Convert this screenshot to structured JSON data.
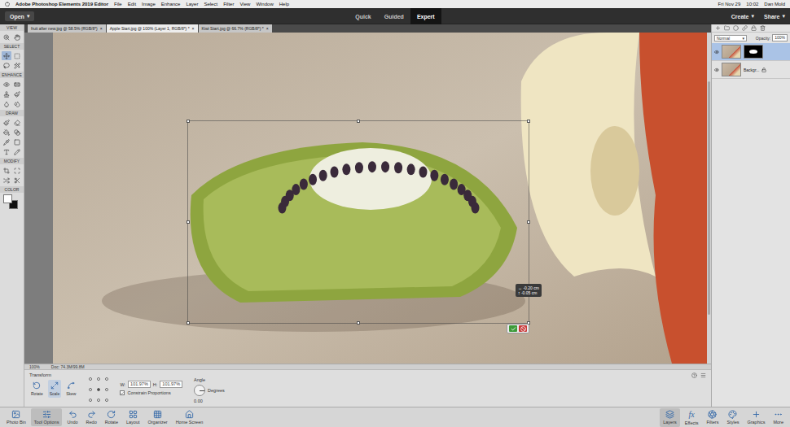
{
  "menubar": {
    "app": "Adobe Photoshop Elements 2019 Editor",
    "items": [
      "File",
      "Edit",
      "Image",
      "Enhance",
      "Layer",
      "Select",
      "Filter",
      "View",
      "Window",
      "Help"
    ],
    "date": "Fri Nov 29",
    "time": "10:02",
    "user": "Dan Mold"
  },
  "topbar": {
    "open": {
      "label": "Open",
      "arrow": "▾"
    },
    "modes": [
      {
        "label": "Quick",
        "selected": false
      },
      {
        "label": "Guided",
        "selected": false
      },
      {
        "label": "Expert",
        "selected": true
      }
    ],
    "actions": [
      {
        "label": "Create",
        "arrow": "▾"
      },
      {
        "label": "Share",
        "arrow": "▾"
      }
    ]
  },
  "doc_tabs": [
    {
      "label": "fruit after new.jpg @ 58.5% (RGB/8*)",
      "close": "×",
      "selected": false
    },
    {
      "label": "Apple Start.jpg @ 100% (Layer 1, RGB/8*) *",
      "close": "×",
      "selected": true
    },
    {
      "label": "Kiwi Start.jpg @ 66.7% (RGB/8*) *",
      "close": "×",
      "selected": false
    }
  ],
  "toolbox": {
    "sections": [
      {
        "label": "VIEW",
        "tools": [
          {
            "selected": false
          },
          {
            "selected": false
          }
        ]
      },
      {
        "label": "SELECT",
        "tools": [
          {
            "selected": true
          },
          {
            "selected": false
          },
          {
            "selected": false
          },
          {
            "selected": false
          }
        ]
      },
      {
        "label": "ENHANCE",
        "tools": [
          {
            "selected": false
          },
          {
            "selected": false
          },
          {
            "selected": false
          },
          {
            "selected": false
          },
          {
            "selected": false
          },
          {
            "selected": false
          }
        ]
      },
      {
        "label": "DRAW",
        "tools": [
          {
            "selected": false
          },
          {
            "selected": false
          },
          {
            "selected": false
          },
          {
            "selected": false
          },
          {
            "selected": false
          },
          {
            "selected": false
          },
          {
            "selected": false
          },
          {
            "selected": false
          }
        ]
      },
      {
        "label": "MODIFY",
        "tools": [
          {
            "selected": false
          },
          {
            "selected": false
          },
          {
            "selected": false
          },
          {
            "selected": false
          }
        ]
      },
      {
        "label": "COLOR",
        "swatches": [
          {
            "color": "#ffffff"
          },
          {
            "color": "#111111"
          }
        ]
      }
    ]
  },
  "canvas": {
    "readout": [
      {
        "glyph": "↔",
        "value": "-0.20 cm"
      },
      {
        "glyph": "↕",
        "value": "-0.05 cm"
      }
    ]
  },
  "status_bar": {
    "zoom": "100%",
    "doc": "Doc: 74.3M/99.8M"
  },
  "tool_options": {
    "title": "Transform",
    "modes": [
      {
        "label": "Rotate",
        "selected": false
      },
      {
        "label": "Scale",
        "selected": true
      },
      {
        "label": "Skew",
        "selected": false
      }
    ],
    "reference_points": [
      {
        "selected": false
      },
      {
        "selected": false
      },
      {
        "selected": false
      },
      {
        "selected": false
      },
      {
        "selected": true
      },
      {
        "selected": false
      },
      {
        "selected": false
      },
      {
        "selected": false
      },
      {
        "selected": false
      }
    ],
    "width": {
      "label": "W:",
      "value": "101.97%"
    },
    "height": {
      "label": "H:",
      "value": "101.97%"
    },
    "constrain": {
      "label": "Constrain Proportions",
      "checked": true
    },
    "angle": {
      "label": "Angle",
      "value": "0.00",
      "unit": "Degrees"
    }
  },
  "layers_panel": {
    "blend_mode": {
      "value": "Normal",
      "arrow": "▾"
    },
    "opacity": {
      "label": "Opacity:",
      "value": "100%"
    },
    "layers": [
      {
        "kind": "masked",
        "visible": true,
        "selected": true
      },
      {
        "name": "Backgr...",
        "kind": "locked",
        "visible": true,
        "selected": false
      }
    ]
  },
  "taskbar": {
    "left": [
      {
        "label": "Photo Bin",
        "selected": false
      },
      {
        "label": "Tool Options",
        "selected": true
      },
      {
        "label": "Undo",
        "selected": false
      },
      {
        "label": "Redo",
        "selected": false
      },
      {
        "label": "Rotate",
        "selected": false
      },
      {
        "label": "Layout",
        "selected": false
      },
      {
        "label": "Organizer",
        "selected": false
      },
      {
        "label": "Home Screen",
        "selected": false
      }
    ],
    "right": [
      {
        "label": "Layers",
        "selected": true
      },
      {
        "label": "Effects",
        "glyph": "fx",
        "selected": false
      },
      {
        "label": "Filters",
        "selected": false
      },
      {
        "label": "Styles",
        "selected": false
      },
      {
        "label": "Graphics",
        "selected": false
      },
      {
        "label": "More",
        "selected": false
      }
    ]
  }
}
